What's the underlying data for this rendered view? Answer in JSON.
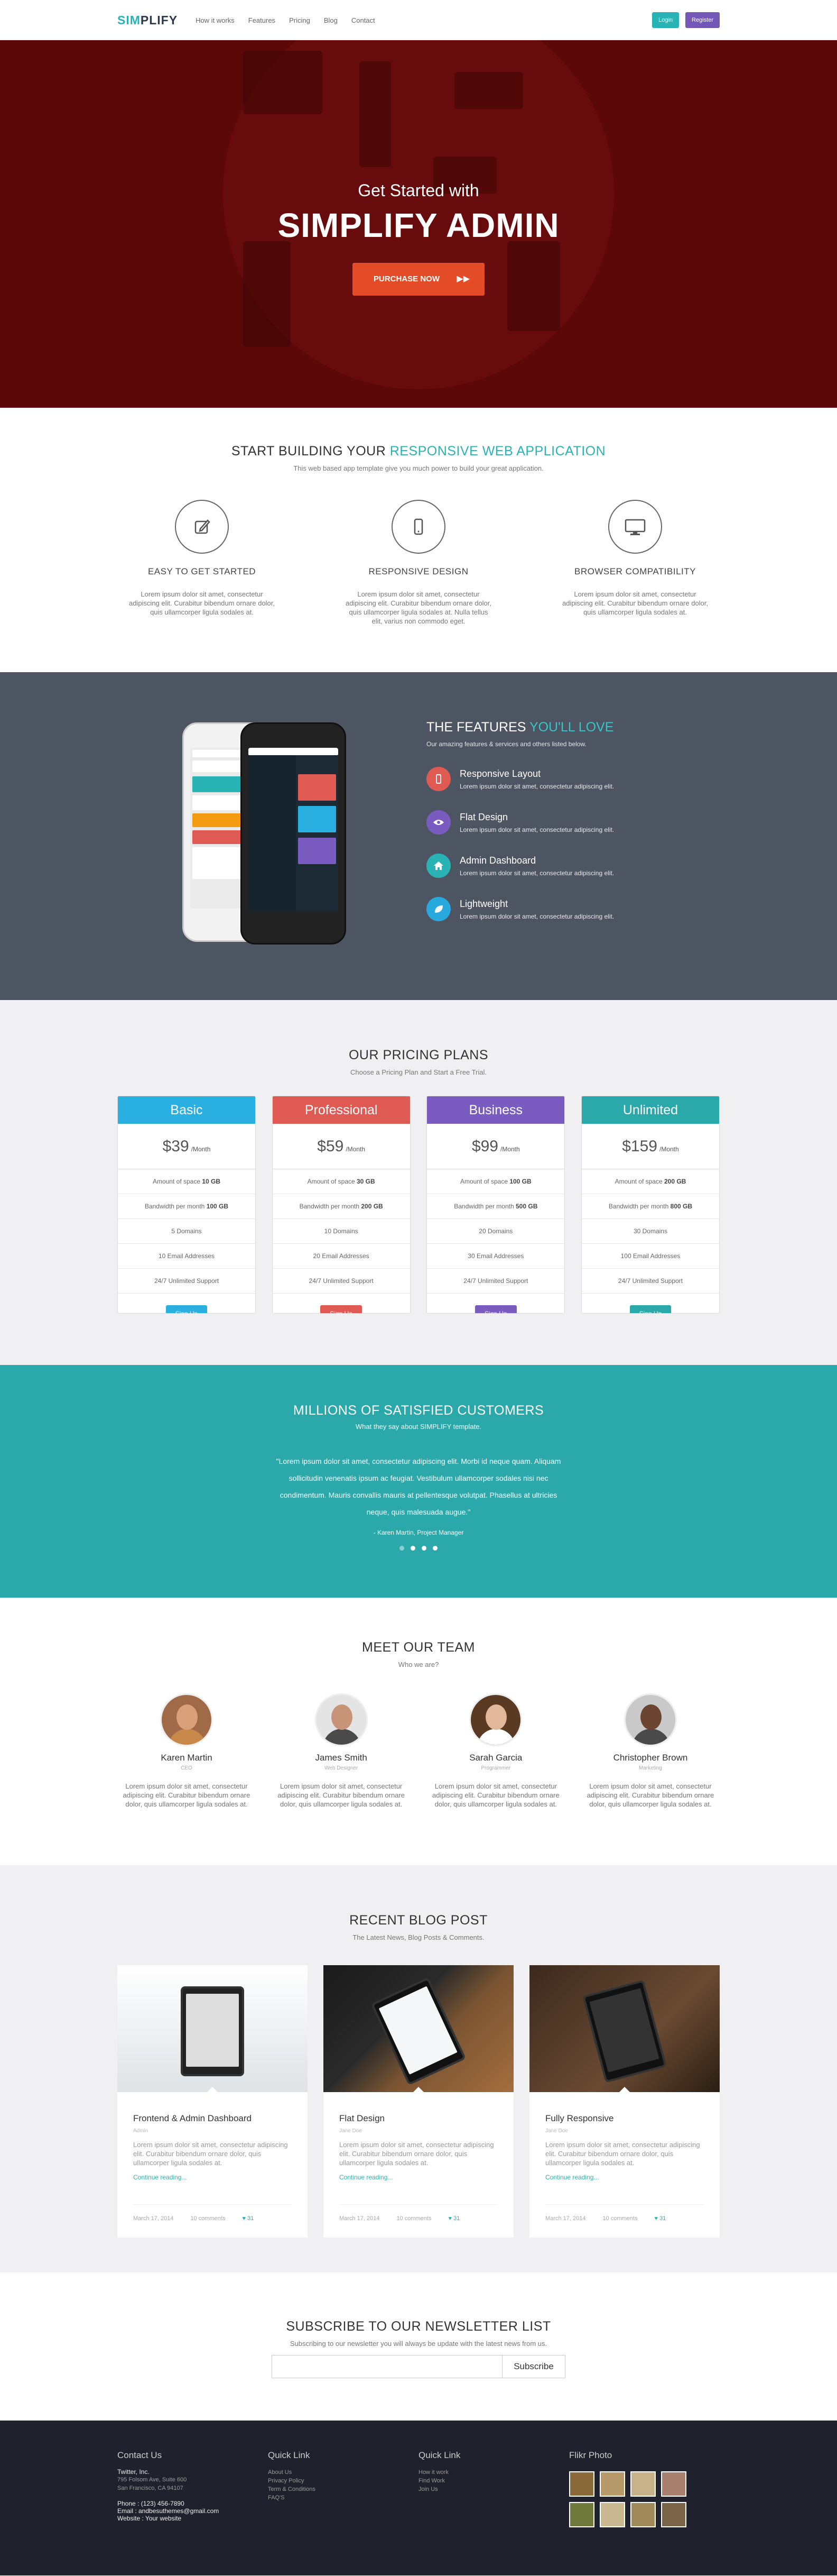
{
  "nav": {
    "logo_a": "SIM",
    "logo_b": "PLIFY",
    "links": [
      "How it works",
      "Features",
      "Pricing",
      "Blog",
      "Contact"
    ],
    "login": "Login",
    "register": "Register"
  },
  "hero": {
    "subtitle": "Get Started with",
    "title": "SIMPLIFY ADMIN",
    "cta": "PURCHASE NOW"
  },
  "intro": {
    "title_a": "START BUILDING YOUR ",
    "title_b": "RESPONSIVE WEB APPLICATION",
    "subtitle": "This web based app template give you much power to build your great application.",
    "items": [
      {
        "icon": "edit-icon",
        "title": "EASY TO GET STARTED",
        "text": "Lorem ipsum dolor sit amet, consectetur adipiscing elit. Curabitur bibendum ornare dolor, quis ullamcorper ligula sodales at."
      },
      {
        "icon": "mobile-icon",
        "title": "RESPONSIVE DESIGN",
        "text": "Lorem ipsum dolor sit amet, consectetur adipiscing elit. Curabitur bibendum ornare dolor, quis ullamcorper ligula sodales at. Nulla tellus elit, varius non commodo eget."
      },
      {
        "icon": "monitor-icon",
        "title": "BROWSER COMPATIBILITY",
        "text": "Lorem ipsum dolor sit amet, consectetur adipiscing elit. Curabitur bibendum ornare dolor, quis ullamcorper ligula sodales at."
      }
    ]
  },
  "features": {
    "title_a": "THE FEATURES ",
    "title_b": "YOU'LL LOVE",
    "intro": "Our amazing features & services and others listed below.",
    "items": [
      {
        "icon": "mobile-icon",
        "color": "#e05a54",
        "title": "Responsive Layout",
        "text": "Lorem ipsum dolor sit amet, consectetur adipiscing elit."
      },
      {
        "icon": "eye-icon",
        "color": "#7a5cc0",
        "title": "Flat Design",
        "text": "Lorem ipsum dolor sit amet, consectetur adipiscing elit."
      },
      {
        "icon": "home-icon",
        "color": "#2ab3b5",
        "title": "Admin Dashboard",
        "text": "Lorem ipsum dolor sit amet, consectetur adipiscing elit."
      },
      {
        "icon": "leaf-icon",
        "color": "#28a9de",
        "title": "Lightweight",
        "text": "Lorem ipsum dolor sit amet, consectetur adipiscing elit."
      }
    ]
  },
  "pricing": {
    "title": "OUR PRICING PLANS",
    "subtitle": "Choose a Pricing Plan and Start a Free Trial.",
    "plans": [
      {
        "name": "Basic",
        "color": "#2ab0e0",
        "price": "$39",
        "per": "/Month",
        "space": "10 GB",
        "bw": "100 GB",
        "domains": "5 Domains",
        "email": "10 Email Addresses",
        "support": "24/7 Unlimited Support",
        "signup": "Sign Up"
      },
      {
        "name": "Professional",
        "color": "#e05a54",
        "price": "$59",
        "per": "/Month",
        "space": "30 GB",
        "bw": "200 GB",
        "domains": "10 Domains",
        "email": "20 Email Addresses",
        "support": "24/7 Unlimited Support",
        "signup": "Sign Up"
      },
      {
        "name": "Business",
        "color": "#7a5cc0",
        "price": "$99",
        "per": "/Month",
        "space": "100 GB",
        "bw": "500 GB",
        "domains": "20 Domains",
        "email": "30 Email Addresses",
        "support": "24/7 Unlimited Support",
        "signup": "Sign Up"
      },
      {
        "name": "Unlimited",
        "color": "#2aa8aa",
        "price": "$159",
        "per": "/Month",
        "space": "200 GB",
        "bw": "800 GB",
        "domains": "30 Domains",
        "email": "100 Email Addresses",
        "support": "24/7 Unlimited Support",
        "signup": "Sign Up"
      }
    ],
    "space_label": "Amount of space ",
    "bw_label": "Bandwidth per month "
  },
  "testimonial": {
    "title": "MILLIONS OF SATISFIED CUSTOMERS",
    "subtitle": "What they say about SIMPLIFY template.",
    "quote": "\"Lorem ipsum dolor sit amet, consectetur adipiscing elit. Morbi id neque quam. Aliquam sollicitudin venenatis ipsum ac feugiat. Vestibulum ullamcorper sodales nisi nec condimentum. Mauris convallis mauris at pellentesque volutpat. Phasellus at ultricies neque, quis malesuada augue.\"",
    "author": "- Karen Martin, Project Manager"
  },
  "team": {
    "title": "MEET OUR TEAM",
    "subtitle": "Who we are?",
    "members": [
      {
        "name": "Karen Martin",
        "role": "CEO",
        "text": "Lorem ipsum dolor sit amet, consectetur adipiscing elit. Curabitur bibendum ornare dolor, quis ullamcorper ligula sodales at."
      },
      {
        "name": "James Smith",
        "role": "Web Designer",
        "text": "Lorem ipsum dolor sit amet, consectetur adipiscing elit. Curabitur bibendum ornare dolor, quis ullamcorper ligula sodales at."
      },
      {
        "name": "Sarah Garcia",
        "role": "Programmer",
        "text": "Lorem ipsum dolor sit amet, consectetur adipiscing elit. Curabitur bibendum ornare dolor, quis ullamcorper ligula sodales at."
      },
      {
        "name": "Christopher Brown",
        "role": "Marketing",
        "text": "Lorem ipsum dolor sit amet, consectetur adipiscing elit. Curabitur bibendum ornare dolor, quis ullamcorper ligula sodales at."
      }
    ]
  },
  "blog": {
    "title": "RECENT BLOG POST",
    "subtitle": "The Latest News, Blog Posts & Comments.",
    "posts": [
      {
        "title": "Frontend & Admin Dashboard",
        "by": "Admin",
        "text": "Lorem ipsum dolor sit amet, consectetur adipiscing elit. Curabitur bibendum ornare dolor, quis ullamcorper ligula sodales at.",
        "more": "Continue reading...",
        "date": "March 17, 2014",
        "comments": "10 comments",
        "likes": "31"
      },
      {
        "title": "Flat Design",
        "by": "Jane Doe",
        "text": "Lorem ipsum dolor sit amet, consectetur adipiscing elit. Curabitur bibendum ornare dolor, quis ullamcorper ligula sodales at.",
        "more": "Continue reading...",
        "date": "March 17, 2014",
        "comments": "10 comments",
        "likes": "31"
      },
      {
        "title": "Fully Responsive",
        "by": "Jane Doe",
        "text": "Lorem ipsum dolor sit amet, consectetur adipiscing elit. Curabitur bibendum ornare dolor, quis ullamcorper ligula sodales at.",
        "more": "Continue reading...",
        "date": "March 17, 2014",
        "comments": "10 comments",
        "likes": "31"
      }
    ]
  },
  "newsletter": {
    "title": "SUBSCRIBE TO OUR NEWSLETTER LIST",
    "subtitle": "Subscribing to our newsletter you will always be update with the latest news from us.",
    "placeholder": "",
    "button": "Subscribe"
  },
  "footer": {
    "contact_title": "Contact Us",
    "company": "Twitter, Inc.",
    "addr1": "795 Folsom Ave, Suite 600",
    "addr2": "San Francisco, CA 94107",
    "phone": "Phone : (123) 456-7890",
    "email": "Email : andbesuthemes@gmail.com",
    "website": "Website : Your website",
    "quick1_title": "Quick Link",
    "quick1": [
      "About Us",
      "Privacy Policy",
      "Term & Conditions",
      "FAQ'S"
    ],
    "quick2_title": "Quick Link",
    "quick2": [
      "How it work",
      "Find Work",
      "Join Us"
    ],
    "flickr_title": "Flikr Photo",
    "flickr_colors": [
      "#8a6a3a",
      "#b89a6a",
      "#c8b28a",
      "#a88070",
      "#6f7a3c",
      "#c9b890",
      "#a18a5a",
      "#7a6448"
    ]
  }
}
